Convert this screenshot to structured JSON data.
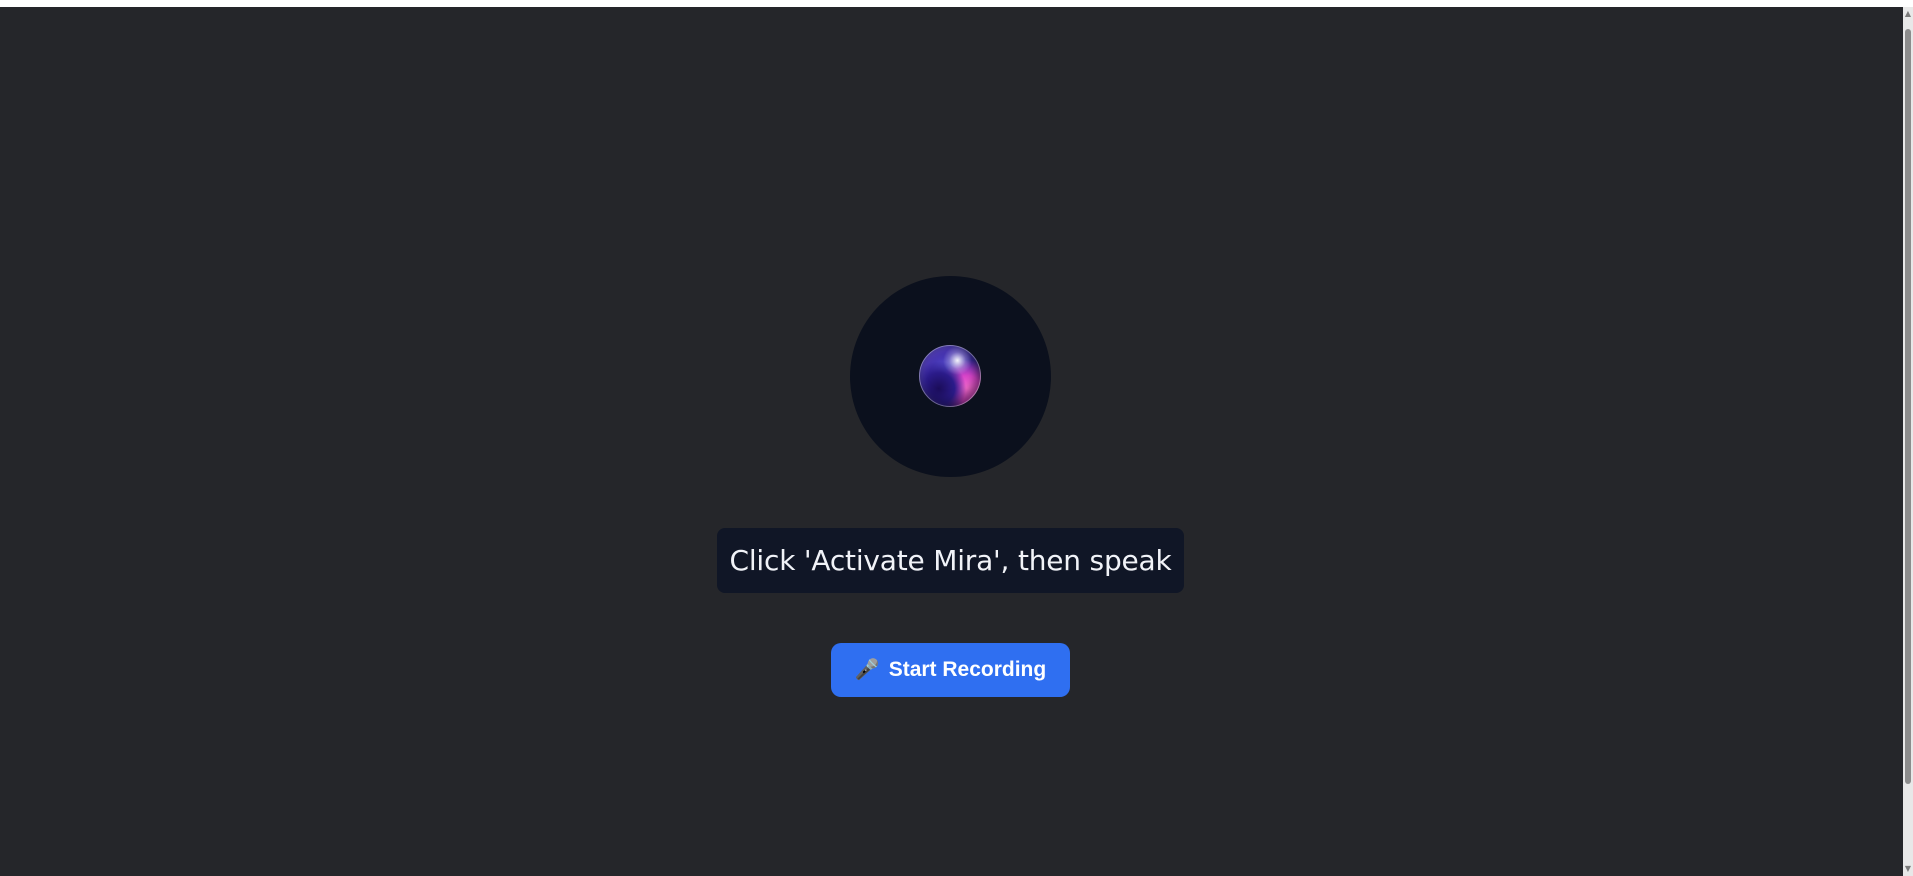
{
  "colors": {
    "background": "#25262a",
    "orb_circle": "#0b101d",
    "status_background": "#101626",
    "accent": "#2f6ff1"
  },
  "status": {
    "text": "Click 'Activate Mira', then speak"
  },
  "record_button": {
    "icon": "microphone-icon",
    "icon_glyph": "🎤",
    "label": "Start Recording"
  }
}
